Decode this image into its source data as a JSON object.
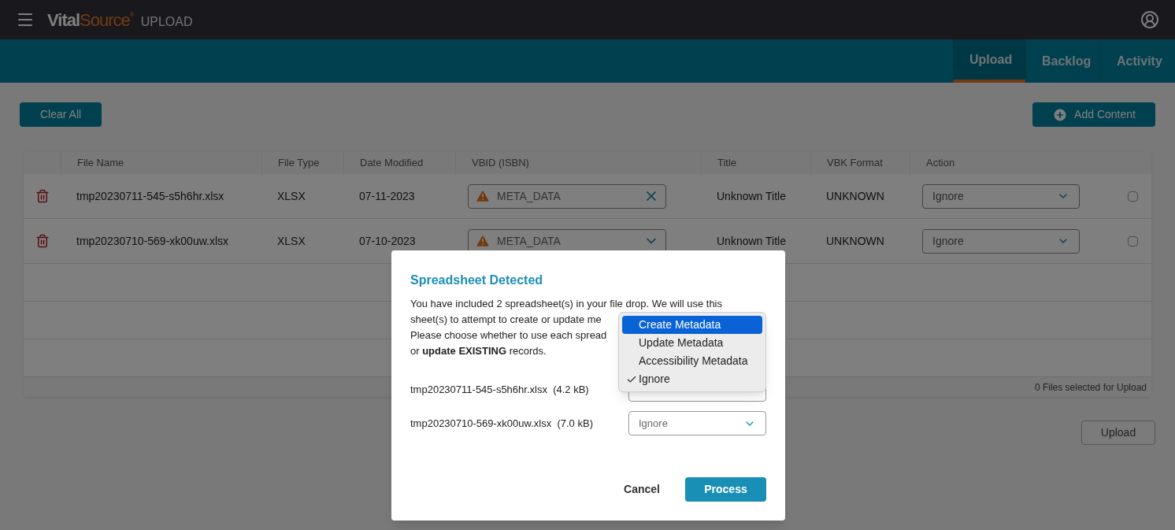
{
  "header": {
    "brand_main": "Vital",
    "brand_accent": "Source",
    "brand_mark": "®",
    "product": "UPLOAD"
  },
  "tabs": [
    {
      "label": "Upload",
      "selected": true
    },
    {
      "label": "Backlog",
      "selected": false
    },
    {
      "label": "Activity",
      "selected": false
    }
  ],
  "toolbar": {
    "clear": "Clear All",
    "add": "Add Content"
  },
  "table": {
    "columns": [
      "File Name",
      "File Type",
      "Date Modified",
      "VBID (ISBN)",
      "Title",
      "VBK Format",
      "Action"
    ],
    "rows": [
      {
        "file_name": "tmp20230711-545-s5h6hr.xlsx",
        "file_type": "XLSX",
        "date": "07-11-2023",
        "vbid": "META_DATA",
        "title": "Unknown Title",
        "format": "UNKNOWN",
        "action": "Ignore",
        "checked": false
      },
      {
        "file_name": "tmp20230710-569-xk00uw.xlsx",
        "file_type": "XLSX",
        "date": "07-10-2023",
        "vbid": "META_DATA",
        "title": "Unknown Title",
        "format": "UNKNOWN",
        "action": "Ignore",
        "checked": false
      }
    ],
    "footer": "0 Files selected for Upload"
  },
  "upload_button": "Upload",
  "dialog": {
    "title": "Spreadsheet Detected",
    "lines": [
      "You have included 2 spreadsheet(s) in your file drop. We will use this",
      "sheet(s) to attempt to create or update me",
      "Please choose whether to use each spread",
      "or **update EXISTING** records."
    ],
    "files": [
      {
        "label": "tmp20230711-545-s5h6hr.xlsx  (4.2 kB)"
      },
      {
        "label": "tmp20230710-569-xk00uw.xlsx  (7.0 kB)",
        "value": "Ignore"
      }
    ],
    "menu": [
      {
        "label": "Create Metadata",
        "selected": true,
        "checked": false
      },
      {
        "label": "Update Metadata",
        "selected": false,
        "checked": false
      },
      {
        "label": "Accessibility Metadata",
        "selected": false,
        "checked": false
      },
      {
        "label": "Ignore",
        "selected": false,
        "checked": true
      }
    ],
    "cancel": "Cancel",
    "process": "Process"
  }
}
